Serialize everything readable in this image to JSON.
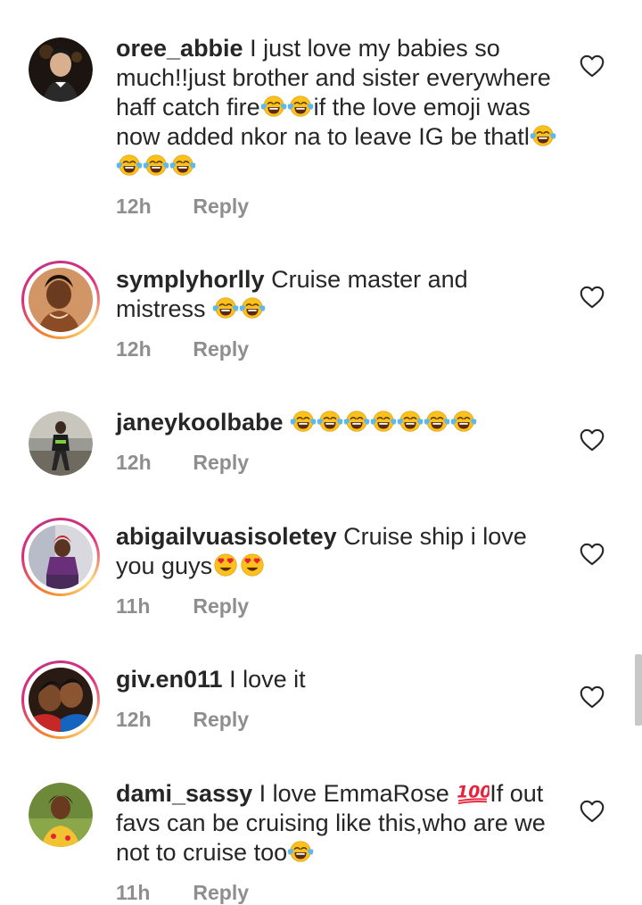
{
  "comments": [
    {
      "username": "oree_abbie",
      "text_parts": [
        "I just love my babies so much!!just brother and sister everywhere haff catch fire",
        "if the love emoji was now added nkor na to leave IG be thatl"
      ],
      "time": "12h",
      "reply_label": "Reply"
    },
    {
      "username": "symplyhorlly",
      "text_parts": [
        "Cruise master and mistress "
      ],
      "time": "12h",
      "reply_label": "Reply"
    },
    {
      "username": "janeykoolbabe",
      "text_parts": [
        " "
      ],
      "time": "12h",
      "reply_label": "Reply"
    },
    {
      "username": "abigailvuasisoletey",
      "text_parts": [
        "Cruise ship i love you guys"
      ],
      "time": "11h",
      "reply_label": "Reply"
    },
    {
      "username": "giv.en011",
      "text_parts": [
        "I love it"
      ],
      "time": "12h",
      "reply_label": "Reply"
    },
    {
      "username": "dami_sassy",
      "text_parts": [
        "I love EmmaRose ",
        "If out favs can be cruising like this,who are we not to cruise too"
      ],
      "time": "11h",
      "reply_label": "Reply"
    }
  ],
  "icons": {
    "like": "heart-outline-icon",
    "laugh": "face-with-tears-of-joy-emoji",
    "heart_eyes": "smiling-face-with-heart-eyes-emoji",
    "hundred": "hundred-points-emoji"
  },
  "colors": {
    "text": "#262626",
    "meta": "#8e8e8e",
    "story_ring_start": "#f58529",
    "story_ring_end": "#dd2a7b",
    "emoji_yellow": "#fcc21b",
    "emoji_tear": "#5db8f0",
    "emoji_heart": "#e8203a",
    "hundred_red": "#e8203a"
  }
}
